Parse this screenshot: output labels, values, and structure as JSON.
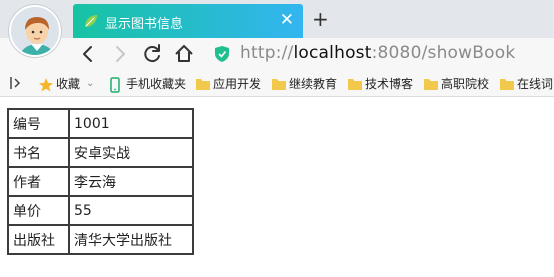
{
  "browser": {
    "tab": {
      "title": "显示图书信息",
      "close_glyph": "✕",
      "favicon": "leaf-icon"
    },
    "new_tab_glyph": "+",
    "address": {
      "scheme": "http://",
      "host": "localhost",
      "rest": ":8080/showBook"
    },
    "colors": {
      "tab_start": "#17c3a3",
      "tab_end": "#33b5f0",
      "secure_shield": "#1fbf8f"
    }
  },
  "bookmarks": {
    "favorites_label": "收藏",
    "favorites_dropdown": "⌄",
    "mobile_label": "手机收藏夹",
    "folders": [
      "应用开发",
      "继续教育",
      "技术博客",
      "高职院校",
      "在线词"
    ]
  },
  "book": {
    "rows": [
      {
        "key": "编号",
        "value": "1001"
      },
      {
        "key": "书名",
        "value": "安卓实战"
      },
      {
        "key": "作者",
        "value": "李云海"
      },
      {
        "key": "单价",
        "value": "55"
      },
      {
        "key": "出版社",
        "value": "清华大学出版社"
      }
    ]
  }
}
